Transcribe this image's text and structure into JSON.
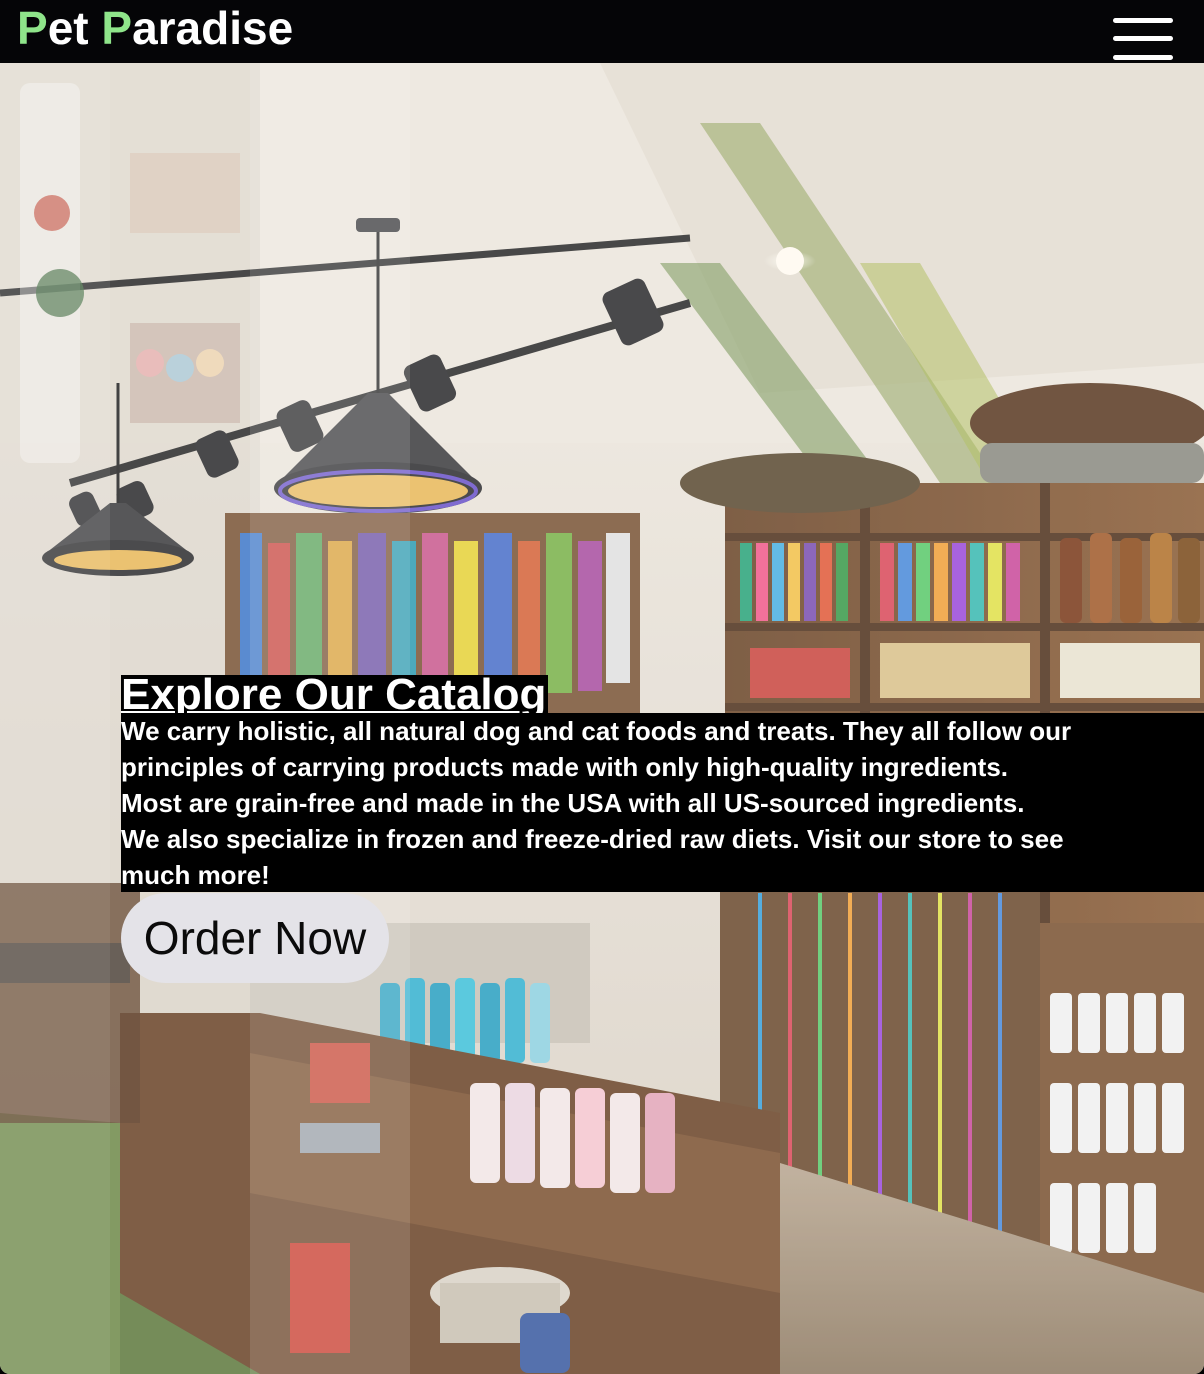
{
  "navbar": {
    "brand_initial_1": "P",
    "brand_rest_1": "et ",
    "brand_initial_2": "P",
    "brand_rest_2": "aradise",
    "brand_accent_color": "#8fe58a",
    "menu_icon": "hamburger-menu-icon"
  },
  "hero": {
    "background_image": "pet-store-interior-photo",
    "title": "Explore Our Catalog",
    "description_lines": [
      "We carry holistic, all natural dog and cat foods and treats. They all follow our",
      "principles of carrying products made with only high-quality ingredients.",
      "Most are grain-free and made in the USA with all US-sourced ingredients.",
      "We also specialize in frozen and freeze-dried raw diets. Visit our store to see",
      "much more!"
    ],
    "cta_label": "Order Now"
  }
}
